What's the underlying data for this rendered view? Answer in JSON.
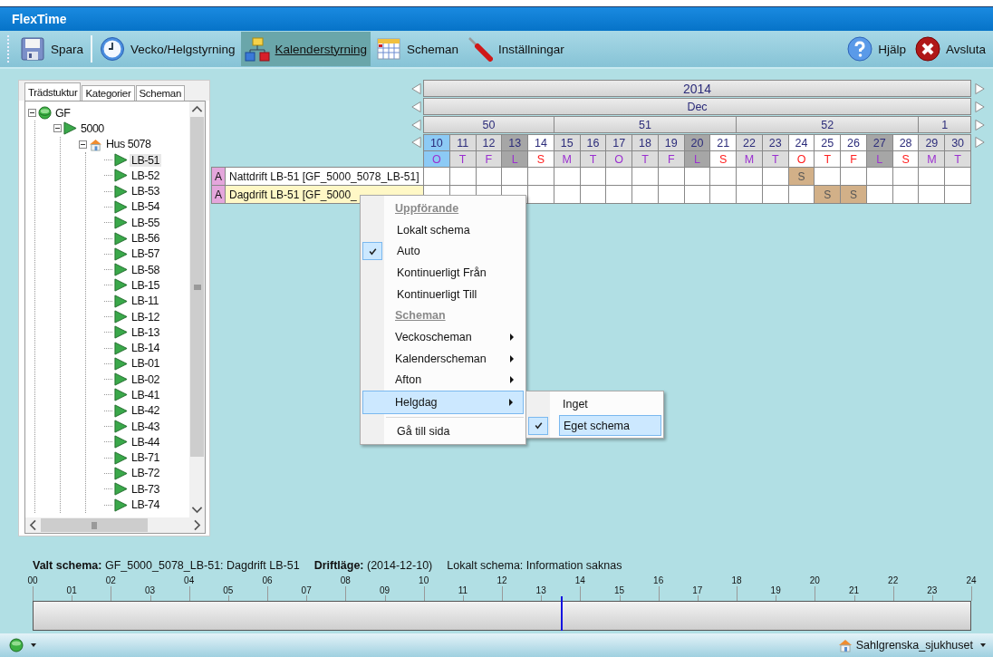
{
  "window": {
    "title": "FlexTime"
  },
  "toolbar": [
    {
      "label": "Spara",
      "kind": "save",
      "selected": false
    },
    {
      "label": "Vecko/Helgstyrning",
      "kind": "clock",
      "selected": false
    },
    {
      "label": "Kalenderstyrning",
      "kind": "org",
      "selected": true
    },
    {
      "label": "Scheman",
      "kind": "calendar",
      "selected": false
    },
    {
      "label": "Inställningar",
      "kind": "tool",
      "selected": false
    }
  ],
  "toolbar_right": [
    {
      "label": "Hjälp",
      "kind": "help"
    },
    {
      "label": "Avsluta",
      "kind": "exit"
    }
  ],
  "tree_tabs": [
    {
      "label": "Trädstuktur",
      "selected": true
    },
    {
      "label": "Kategorier",
      "selected": false
    },
    {
      "label": "Scheman",
      "selected": false
    }
  ],
  "tree": [
    {
      "label": "GF",
      "kind": "globe",
      "expanded": true,
      "selected": false,
      "children": [
        {
          "label": "5000",
          "kind": "flag",
          "expanded": true,
          "selected": false,
          "children": [
            {
              "label": "Hus 5078",
              "kind": "house",
              "expanded": true,
              "selected": false,
              "children": [
                {
                  "label": "LB-51",
                  "kind": "flag",
                  "selected": true
                },
                {
                  "label": "LB-52",
                  "kind": "flag",
                  "selected": false
                },
                {
                  "label": "LB-53",
                  "kind": "flag",
                  "selected": false
                },
                {
                  "label": "LB-54",
                  "kind": "flag",
                  "selected": false
                },
                {
                  "label": "LB-55",
                  "kind": "flag",
                  "selected": false
                },
                {
                  "label": "LB-56",
                  "kind": "flag",
                  "selected": false
                },
                {
                  "label": "LB-57",
                  "kind": "flag",
                  "selected": false
                },
                {
                  "label": "LB-58",
                  "kind": "flag",
                  "selected": false
                },
                {
                  "label": "LB-15",
                  "kind": "flag",
                  "selected": false
                },
                {
                  "label": "LB-11",
                  "kind": "flag",
                  "selected": false
                },
                {
                  "label": "LB-12",
                  "kind": "flag",
                  "selected": false
                },
                {
                  "label": "LB-13",
                  "kind": "flag",
                  "selected": false
                },
                {
                  "label": "LB-14",
                  "kind": "flag",
                  "selected": false
                },
                {
                  "label": "LB-01",
                  "kind": "flag",
                  "selected": false
                },
                {
                  "label": "LB-02",
                  "kind": "flag",
                  "selected": false
                },
                {
                  "label": "LB-41",
                  "kind": "flag",
                  "selected": false
                },
                {
                  "label": "LB-42",
                  "kind": "flag",
                  "selected": false
                },
                {
                  "label": "LB-43",
                  "kind": "flag",
                  "selected": false
                },
                {
                  "label": "LB-44",
                  "kind": "flag",
                  "selected": false
                },
                {
                  "label": "LB-71",
                  "kind": "flag",
                  "selected": false
                },
                {
                  "label": "LB-72",
                  "kind": "flag",
                  "selected": false
                },
                {
                  "label": "LB-73",
                  "kind": "flag",
                  "selected": false
                },
                {
                  "label": "LB-74",
                  "kind": "flag",
                  "selected": false
                }
              ]
            }
          ]
        }
      ]
    }
  ],
  "calendar": {
    "year": "2014",
    "month": "Dec",
    "weeks": [
      {
        "label": "50",
        "days": [
          {
            "number": "10",
            "letter": "O",
            "kind": "today"
          },
          {
            "number": "11",
            "letter": "T",
            "kind": "weekday"
          },
          {
            "number": "12",
            "letter": "F",
            "kind": "weekday"
          },
          {
            "number": "13",
            "letter": "L",
            "kind": "saturday"
          },
          {
            "number": "14",
            "letter": "S",
            "kind": "holiday"
          }
        ]
      },
      {
        "label": "51",
        "days": [
          {
            "number": "15",
            "letter": "M",
            "kind": "weekday"
          },
          {
            "number": "16",
            "letter": "T",
            "kind": "weekday"
          },
          {
            "number": "17",
            "letter": "O",
            "kind": "weekday"
          },
          {
            "number": "18",
            "letter": "T",
            "kind": "weekday"
          },
          {
            "number": "19",
            "letter": "F",
            "kind": "weekday"
          },
          {
            "number": "20",
            "letter": "L",
            "kind": "saturday"
          },
          {
            "number": "21",
            "letter": "S",
            "kind": "holiday"
          }
        ]
      },
      {
        "label": "52",
        "days": [
          {
            "number": "22",
            "letter": "M",
            "kind": "weekday"
          },
          {
            "number": "23",
            "letter": "T",
            "kind": "weekday"
          },
          {
            "number": "24",
            "letter": "O",
            "kind": "holiday"
          },
          {
            "number": "25",
            "letter": "T",
            "kind": "holiday"
          },
          {
            "number": "26",
            "letter": "F",
            "kind": "holiday"
          },
          {
            "number": "27",
            "letter": "L",
            "kind": "saturday"
          },
          {
            "number": "28",
            "letter": "S",
            "kind": "holiday"
          }
        ]
      },
      {
        "label": "1",
        "days": [
          {
            "number": "29",
            "letter": "M",
            "kind": "weekday"
          },
          {
            "number": "30",
            "letter": "T",
            "kind": "weekday"
          }
        ]
      }
    ],
    "rows": [
      {
        "flag": "A",
        "label": "Nattdrift LB-51 [GF_5000_5078_LB-51]",
        "selected": false,
        "cells": [
          {
            "scheduled": false
          },
          {
            "scheduled": false
          },
          {
            "scheduled": false
          },
          {
            "scheduled": false
          },
          {
            "scheduled": false
          },
          {
            "scheduled": false
          },
          {
            "scheduled": false
          },
          {
            "scheduled": false
          },
          {
            "scheduled": false
          },
          {
            "scheduled": false
          },
          {
            "scheduled": false
          },
          {
            "scheduled": false
          },
          {
            "scheduled": false
          },
          {
            "scheduled": false
          },
          {
            "scheduled": true,
            "text": "S"
          },
          {
            "scheduled": false
          },
          {
            "scheduled": false
          },
          {
            "scheduled": false
          },
          {
            "scheduled": false
          },
          {
            "scheduled": false
          },
          {
            "scheduled": false
          }
        ]
      },
      {
        "flag": "A",
        "label": "Dagdrift LB-51 [GF_5000_",
        "selected": true,
        "cells": [
          {
            "scheduled": false
          },
          {
            "scheduled": false
          },
          {
            "scheduled": false
          },
          {
            "scheduled": false
          },
          {
            "scheduled": false
          },
          {
            "scheduled": false
          },
          {
            "scheduled": false
          },
          {
            "scheduled": false
          },
          {
            "scheduled": false
          },
          {
            "scheduled": false
          },
          {
            "scheduled": false
          },
          {
            "scheduled": false
          },
          {
            "scheduled": false
          },
          {
            "scheduled": false
          },
          {
            "scheduled": false
          },
          {
            "scheduled": true,
            "text": "S"
          },
          {
            "scheduled": true,
            "text": "S"
          },
          {
            "scheduled": false
          },
          {
            "scheduled": false
          },
          {
            "scheduled": false
          },
          {
            "scheduled": false
          }
        ]
      }
    ]
  },
  "context_menu": [
    {
      "label": "Uppförande",
      "kind": "header"
    },
    {
      "label": "Lokalt schema",
      "kind": "item",
      "checked": false,
      "selected": false
    },
    {
      "label": "Auto",
      "kind": "item",
      "checked": true,
      "selected": false
    },
    {
      "label": "Kontinuerligt Från",
      "kind": "item",
      "checked": false,
      "selected": false
    },
    {
      "label": "Kontinuerligt Till",
      "kind": "item",
      "checked": false,
      "selected": false
    },
    {
      "label": "Scheman",
      "kind": "header"
    },
    {
      "label": "Veckoscheman",
      "kind": "submenu",
      "selected": false
    },
    {
      "label": "Kalenderscheman",
      "kind": "submenu",
      "selected": false
    },
    {
      "label": "Afton",
      "kind": "submenu",
      "selected": false
    },
    {
      "label": "Helgdag",
      "kind": "submenu",
      "selected": true
    },
    {
      "kind": "separator"
    },
    {
      "label": "Gå till sida",
      "kind": "item",
      "checked": false,
      "selected": false
    }
  ],
  "submenu": [
    {
      "label": "Inget",
      "checked": false,
      "selected": false
    },
    {
      "label": "Eget schema",
      "checked": true,
      "selected": true
    }
  ],
  "info": [
    "**Valt schema:** GF_5000_5078_LB-51: Dagdrift LB-51",
    "**Driftläge:** (2014-12-10)",
    "Lokalt schema: Information saknas"
  ],
  "timeline": {
    "hours": [
      "00",
      "01",
      "02",
      "03",
      "04",
      "05",
      "06",
      "07",
      "08",
      "09",
      "10",
      "11",
      "12",
      "13",
      "14",
      "15",
      "16",
      "17",
      "18",
      "19",
      "20",
      "21",
      "22",
      "23",
      "24"
    ],
    "level": 0.563
  },
  "status_bar": {
    "location": "Sahlgrenska_sjukhuset"
  }
}
